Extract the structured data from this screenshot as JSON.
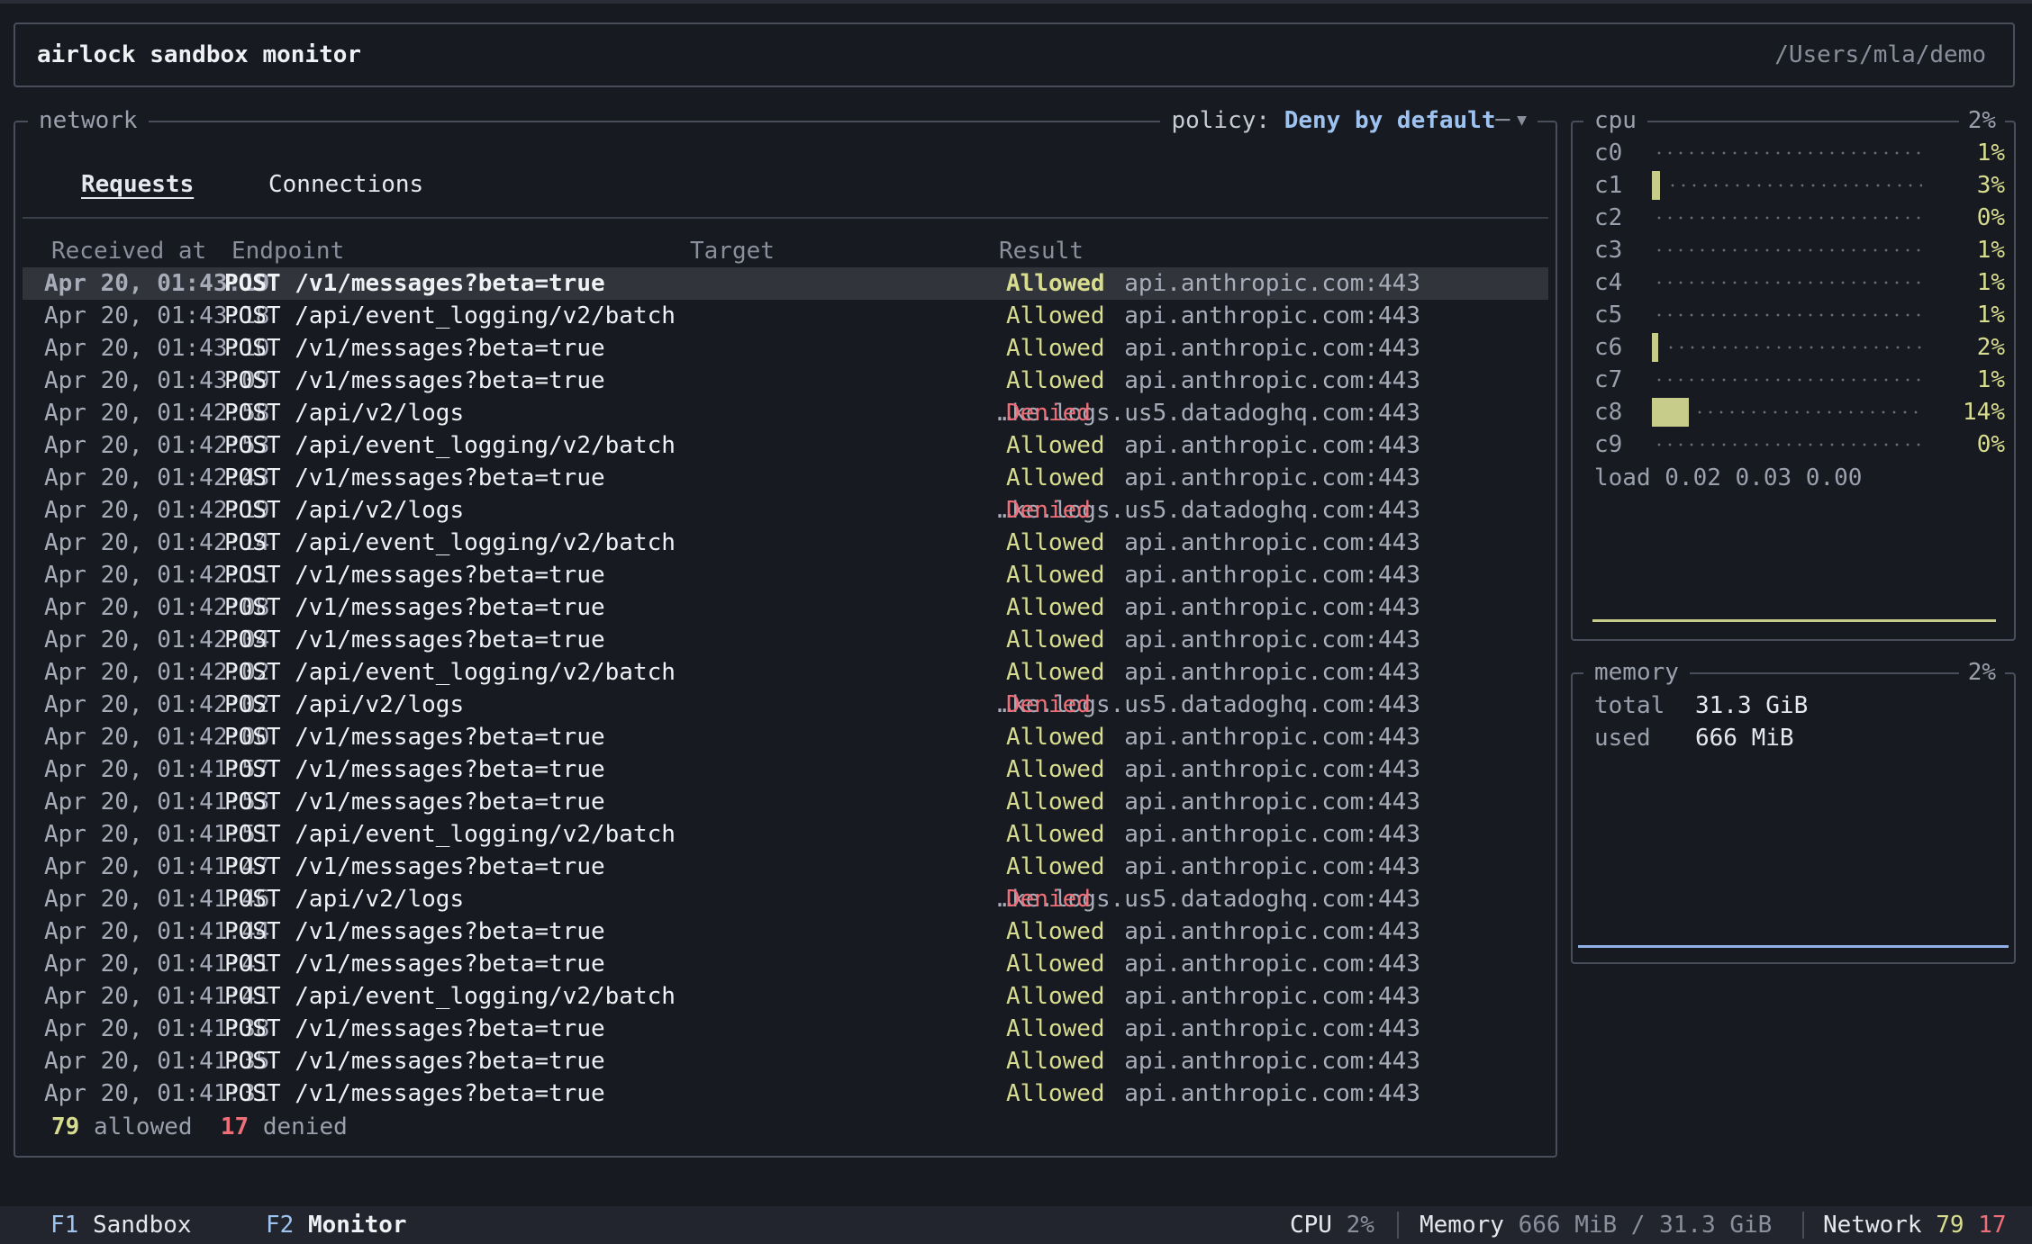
{
  "header": {
    "title": "airlock sandbox monitor",
    "path": "/Users/mla/demo"
  },
  "network": {
    "title": "network",
    "policy_label": "policy:",
    "policy_value": "Deny by default",
    "tabs": [
      {
        "label": "Requests",
        "active": true
      },
      {
        "label": "Connections",
        "active": false
      }
    ],
    "columns": {
      "received": "Received at",
      "endpoint": "Endpoint",
      "target": "Target",
      "result": "Result"
    },
    "requests": [
      {
        "time": "Apr 20, 01:43:19",
        "endpoint": "POST /v1/messages?beta=true",
        "target": "api.anthropic.com:443",
        "result": "Allowed"
      },
      {
        "time": "Apr 20, 01:43:18",
        "endpoint": "POST /api/event_logging/v2/batch",
        "target": "api.anthropic.com:443",
        "result": "Allowed"
      },
      {
        "time": "Apr 20, 01:43:10",
        "endpoint": "POST /v1/messages?beta=true",
        "target": "api.anthropic.com:443",
        "result": "Allowed"
      },
      {
        "time": "Apr 20, 01:43:09",
        "endpoint": "POST /v1/messages?beta=true",
        "target": "api.anthropic.com:443",
        "result": "Allowed"
      },
      {
        "time": "Apr 20, 01:42:58",
        "endpoint": "POST /api/v2/logs",
        "target": "…ke.logs.us5.datadoghq.com:443",
        "result": "Denied"
      },
      {
        "time": "Apr 20, 01:42:53",
        "endpoint": "POST /api/event_logging/v2/batch",
        "target": "api.anthropic.com:443",
        "result": "Allowed"
      },
      {
        "time": "Apr 20, 01:42:43",
        "endpoint": "POST /v1/messages?beta=true",
        "target": "api.anthropic.com:443",
        "result": "Allowed"
      },
      {
        "time": "Apr 20, 01:42:19",
        "endpoint": "POST /api/v2/logs",
        "target": "…ke.logs.us5.datadoghq.com:443",
        "result": "Denied"
      },
      {
        "time": "Apr 20, 01:42:14",
        "endpoint": "POST /api/event_logging/v2/batch",
        "target": "api.anthropic.com:443",
        "result": "Allowed"
      },
      {
        "time": "Apr 20, 01:42:11",
        "endpoint": "POST /v1/messages?beta=true",
        "target": "api.anthropic.com:443",
        "result": "Allowed"
      },
      {
        "time": "Apr 20, 01:42:08",
        "endpoint": "POST /v1/messages?beta=true",
        "target": "api.anthropic.com:443",
        "result": "Allowed"
      },
      {
        "time": "Apr 20, 01:42:04",
        "endpoint": "POST /v1/messages?beta=true",
        "target": "api.anthropic.com:443",
        "result": "Allowed"
      },
      {
        "time": "Apr 20, 01:42:02",
        "endpoint": "POST /api/event_logging/v2/batch",
        "target": "api.anthropic.com:443",
        "result": "Allowed"
      },
      {
        "time": "Apr 20, 01:42:02",
        "endpoint": "POST /api/v2/logs",
        "target": "…ke.logs.us5.datadoghq.com:443",
        "result": "Denied"
      },
      {
        "time": "Apr 20, 01:42:00",
        "endpoint": "POST /v1/messages?beta=true",
        "target": "api.anthropic.com:443",
        "result": "Allowed"
      },
      {
        "time": "Apr 20, 01:41:57",
        "endpoint": "POST /v1/messages?beta=true",
        "target": "api.anthropic.com:443",
        "result": "Allowed"
      },
      {
        "time": "Apr 20, 01:41:53",
        "endpoint": "POST /v1/messages?beta=true",
        "target": "api.anthropic.com:443",
        "result": "Allowed"
      },
      {
        "time": "Apr 20, 01:41:51",
        "endpoint": "POST /api/event_logging/v2/batch",
        "target": "api.anthropic.com:443",
        "result": "Allowed"
      },
      {
        "time": "Apr 20, 01:41:47",
        "endpoint": "POST /v1/messages?beta=true",
        "target": "api.anthropic.com:443",
        "result": "Allowed"
      },
      {
        "time": "Apr 20, 01:41:46",
        "endpoint": "POST /api/v2/logs",
        "target": "…ke.logs.us5.datadoghq.com:443",
        "result": "Denied"
      },
      {
        "time": "Apr 20, 01:41:44",
        "endpoint": "POST /v1/messages?beta=true",
        "target": "api.anthropic.com:443",
        "result": "Allowed"
      },
      {
        "time": "Apr 20, 01:41:41",
        "endpoint": "POST /v1/messages?beta=true",
        "target": "api.anthropic.com:443",
        "result": "Allowed"
      },
      {
        "time": "Apr 20, 01:41:41",
        "endpoint": "POST /api/event_logging/v2/batch",
        "target": "api.anthropic.com:443",
        "result": "Allowed"
      },
      {
        "time": "Apr 20, 01:41:38",
        "endpoint": "POST /v1/messages?beta=true",
        "target": "api.anthropic.com:443",
        "result": "Allowed"
      },
      {
        "time": "Apr 20, 01:41:35",
        "endpoint": "POST /v1/messages?beta=true",
        "target": "api.anthropic.com:443",
        "result": "Allowed"
      },
      {
        "time": "Apr 20, 01:41:31",
        "endpoint": "POST /v1/messages?beta=true",
        "target": "api.anthropic.com:443",
        "result": "Allowed"
      }
    ],
    "summary": {
      "allowed_count": "79",
      "allowed_label": "allowed",
      "denied_count": "17",
      "denied_label": "denied"
    }
  },
  "cpu": {
    "title": "cpu",
    "total": "2%",
    "cores": [
      {
        "name": "c0",
        "pct": "1%",
        "level": 0.01
      },
      {
        "name": "c1",
        "pct": "3%",
        "level": 0.03
      },
      {
        "name": "c2",
        "pct": "0%",
        "level": 0.0
      },
      {
        "name": "c3",
        "pct": "1%",
        "level": 0.01
      },
      {
        "name": "c4",
        "pct": "1%",
        "level": 0.01
      },
      {
        "name": "c5",
        "pct": "1%",
        "level": 0.01
      },
      {
        "name": "c6",
        "pct": "2%",
        "level": 0.02
      },
      {
        "name": "c7",
        "pct": "1%",
        "level": 0.01
      },
      {
        "name": "c8",
        "pct": "14%",
        "level": 0.14
      },
      {
        "name": "c9",
        "pct": "0%",
        "level": 0.0
      }
    ],
    "load": "load 0.02 0.03 0.00"
  },
  "memory": {
    "title": "memory",
    "pct": "2%",
    "total_label": "total",
    "total_value": "31.3 GiB",
    "used_label": "used",
    "used_value": "666 MiB"
  },
  "statusbar": {
    "f1_key": "F1",
    "f1_label": "Sandbox",
    "f2_key": "F2",
    "f2_label": "Monitor",
    "cpu_label": "CPU",
    "cpu_value": "2%",
    "memory_label": "Memory",
    "memory_value": "666 MiB / 31.3 GiB",
    "network_label": "Network",
    "network_allowed": "79",
    "network_denied": "17"
  },
  "colors": {
    "background": "#181a22",
    "allowed": "#d7dc8e",
    "denied": "#ef6f78",
    "accent": "#9ec3f0"
  },
  "icons": {
    "policy_dropdown": "chevron-down-icon"
  }
}
